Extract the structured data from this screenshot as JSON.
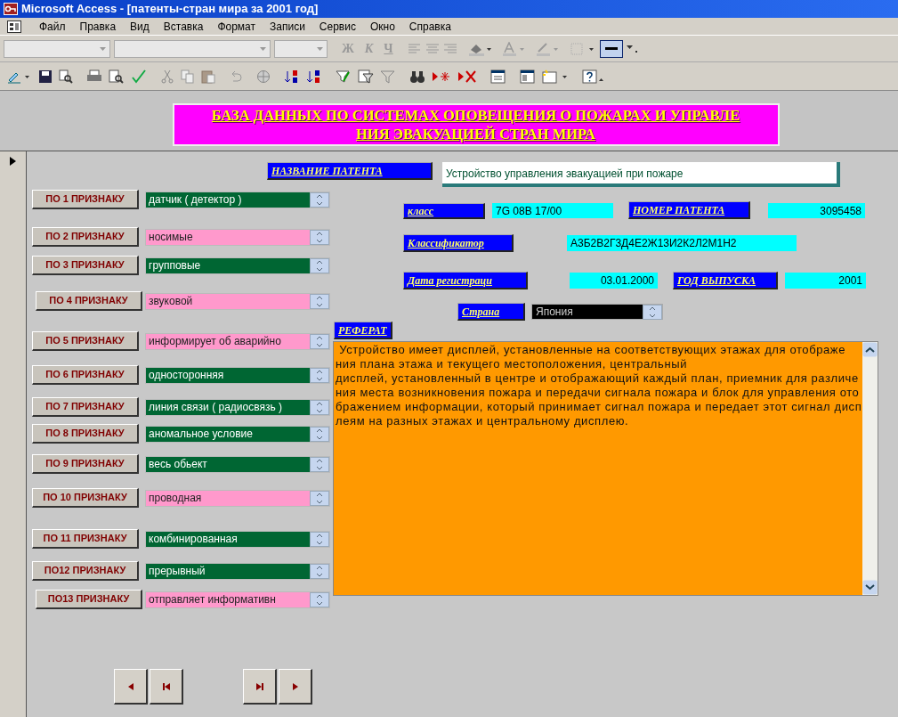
{
  "window": {
    "title": "Microsoft Access - [патенты-стран мира за 2001 год]"
  },
  "menu": [
    "Файл",
    "Правка",
    "Вид",
    "Вставка",
    "Формат",
    "Записи",
    "Сервис",
    "Окно",
    "Справка"
  ],
  "format_buttons": [
    "Ж",
    "К",
    "Ч"
  ],
  "form_title": [
    "БАЗА ДАННЫХ ПО СИСТЕМАХ ОПОВЕЩЕНИЯ О ПОЖАРАХ И УПРАВЛЕ",
    "НИЯ ЭВАКУАЦИЕЙ СТРАН МИРА"
  ],
  "criteria": [
    {
      "label": "ПО 1 ПРИЗНАКУ",
      "value": "датчик ( детектор )",
      "color": "#006633"
    },
    {
      "label": "ПО 2 ПРИЗНАКУ",
      "value": "носимые",
      "color": "#ff99cc"
    },
    {
      "label": "ПО 3 ПРИЗНАКУ",
      "value": "групповые",
      "color": "#006633"
    },
    {
      "label": "ПО 4 ПРИЗНАКУ",
      "value": "звуковой",
      "color": "#ff99cc"
    },
    {
      "label": "ПО 5 ПРИЗНАКУ",
      "value": "информирует об аварийно",
      "color": "#ff99cc"
    },
    {
      "label": "ПО 6 ПРИЗНАКУ",
      "value": "односторонняя",
      "color": "#006633"
    },
    {
      "label": "ПО 7 ПРИЗНАКУ",
      "value": "линия связи ( радиосвязь )",
      "color": "#006633"
    },
    {
      "label": "ПО 8 ПРИЗНАКУ",
      "value": "аномальное условие",
      "color": "#006633"
    },
    {
      "label": "ПО 9 ПРИЗНАКУ",
      "value": "весь обьект",
      "color": "#006633"
    },
    {
      "label": "ПО 10 ПРИЗНАКУ",
      "value": "проводная",
      "color": "#ff99cc"
    },
    {
      "label": "ПО 11 ПРИЗНАКУ",
      "value": "комбинированная",
      "color": "#006633"
    },
    {
      "label": "ПО12 ПРИЗНАКУ",
      "value": "прерывный",
      "color": "#006633"
    },
    {
      "label": "ПО13 ПРИЗНАКУ",
      "value": "отправляет информативн",
      "color": "#ff99cc"
    }
  ],
  "patent_name": {
    "label": "НАЗВАНИЕ ПАТЕНТА",
    "value": "Устройство управления эвакуацией при пожаре"
  },
  "class": {
    "label": "класс",
    "value": "7G 08B 17/00"
  },
  "patent_number": {
    "label": "НОМЕР ПАТЕНТА",
    "value": "3095458"
  },
  "classifier": {
    "label": "Классификатор",
    "value": "А3Б2В2Г3Д4Е2Ж13И2К2Л2М1Н2"
  },
  "registration_date": {
    "label": "Дата регистраци",
    "value": "03.01.2000"
  },
  "issue_year": {
    "label": "ГОД ВЫПУСКА",
    "value": "2001"
  },
  "country": {
    "label": "Страна",
    "value": "Япония"
  },
  "abstract": {
    "label": "РЕФЕРАТ",
    "lines": [
      " Устройство имеет дисплей, установленные на соответствующих этажах для отображе",
      "ния плана этажа и текущего местоположения, центральный",
      "дисплей, установленный в центре и отображающий каждый план, приемник для различе",
      "ния места возникновения пожара и передачи сигнала пожара и блок для управления ото",
      "бражением информации, который принимает сигнал пожара и передает этот сигнал дисп",
      "леям на разных этажах и центральному дисплею."
    ]
  }
}
